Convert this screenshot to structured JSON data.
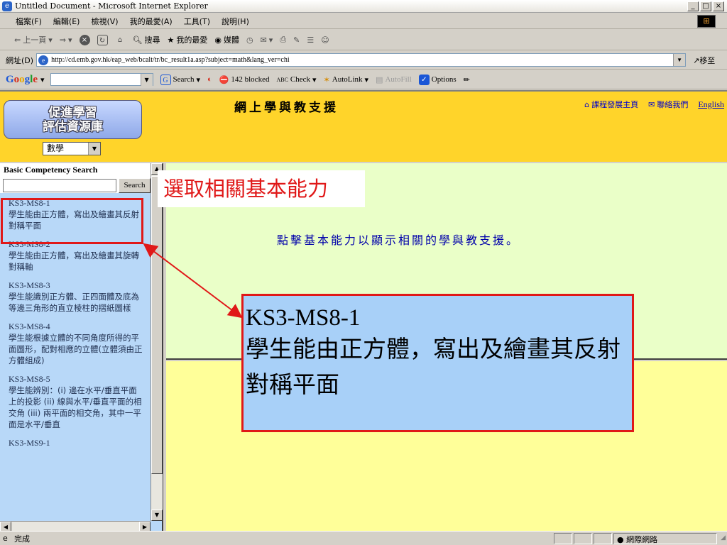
{
  "window": {
    "title": "Untitled Document - Microsoft Internet Explorer"
  },
  "menu": [
    "檔案(F)",
    "編輯(E)",
    "檢視(V)",
    "我的最愛(A)",
    "工具(T)",
    "說明(H)"
  ],
  "toolbar": {
    "back": "上一頁",
    "search": "搜尋",
    "favorites": "我的最愛",
    "media": "媒體"
  },
  "address": {
    "label": "網址(D)",
    "url": "http://cd.emb.gov.hk/eap_web/bcalt/tr/bc_result1a.asp?subject=math&lang_ver=chi",
    "go": "移至"
  },
  "google": {
    "logo": "Google",
    "search": "Search",
    "blocked": "142 blocked",
    "check": "Check",
    "autolink": "AutoLink",
    "autofill": "AutoFill",
    "options": "Options"
  },
  "header": {
    "logo_line1": "促進學習",
    "logo_line2": "評估資源庫",
    "subject": "數學",
    "title": "網上學與教支援",
    "home_link": "課程發展主頁",
    "contact_link": "聯絡我們",
    "english_link": "English"
  },
  "sidebar": {
    "heading": "Basic Competency Search",
    "search_button": "Search",
    "items": [
      {
        "code": "KS3-MS8-1",
        "text": "學生能由正方體，寫出及繪畫其反射對稱平面"
      },
      {
        "code": "KS3-MS8-2",
        "text": "學生能由正方體，寫出及繪畫其旋轉對稱軸"
      },
      {
        "code": "KS3-MS8-3",
        "text": "學生能識別正方體、正四面體及底為等邊三角形的直立棱柱的摺紙圖樣"
      },
      {
        "code": "KS3-MS8-4",
        "text": "學生能根據立體的不同角度所得的平面圖形，配對相應的立體(立體須由正方體組成)"
      },
      {
        "code": "KS3-MS8-5",
        "text": "學生能辨別：(i) 邊在水平/垂直平面上的投影 (ii) 線與水平/垂直平面的相交角 (iii) 兩平面的相交角，其中一平面是水平/垂直"
      },
      {
        "code": "KS3-MS9-1",
        "text": ""
      }
    ]
  },
  "main": {
    "hint": "點擊基本能力以顯示相關的學與教支援。",
    "callout_title": "選取相關基本能力",
    "selected_code": "KS3-MS8-1",
    "selected_text": "學生能由正方體，寫出及繪畫其反射對稱平面"
  },
  "status": {
    "left": "完成",
    "zone": "網際網路"
  }
}
